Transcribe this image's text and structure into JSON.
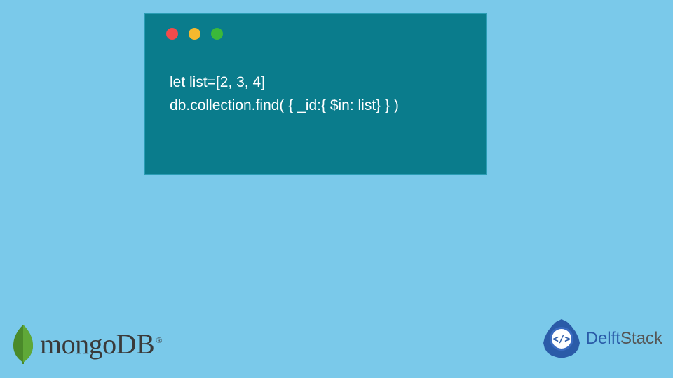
{
  "code": {
    "line1": "let list=[2, 3, 4]",
    "line2": "db.collection.find( { _id:{ $in: list} } )"
  },
  "mongo": {
    "text": "mongoDB",
    "trademark": "®"
  },
  "delft": {
    "part1": "Delft",
    "part2": "Stack"
  },
  "colors": {
    "background": "#7ac9ea",
    "codeWindow": "#0a7c8c",
    "dotRed": "#f24b4b",
    "dotYellow": "#f5b82e",
    "dotGreen": "#3bb93b"
  }
}
